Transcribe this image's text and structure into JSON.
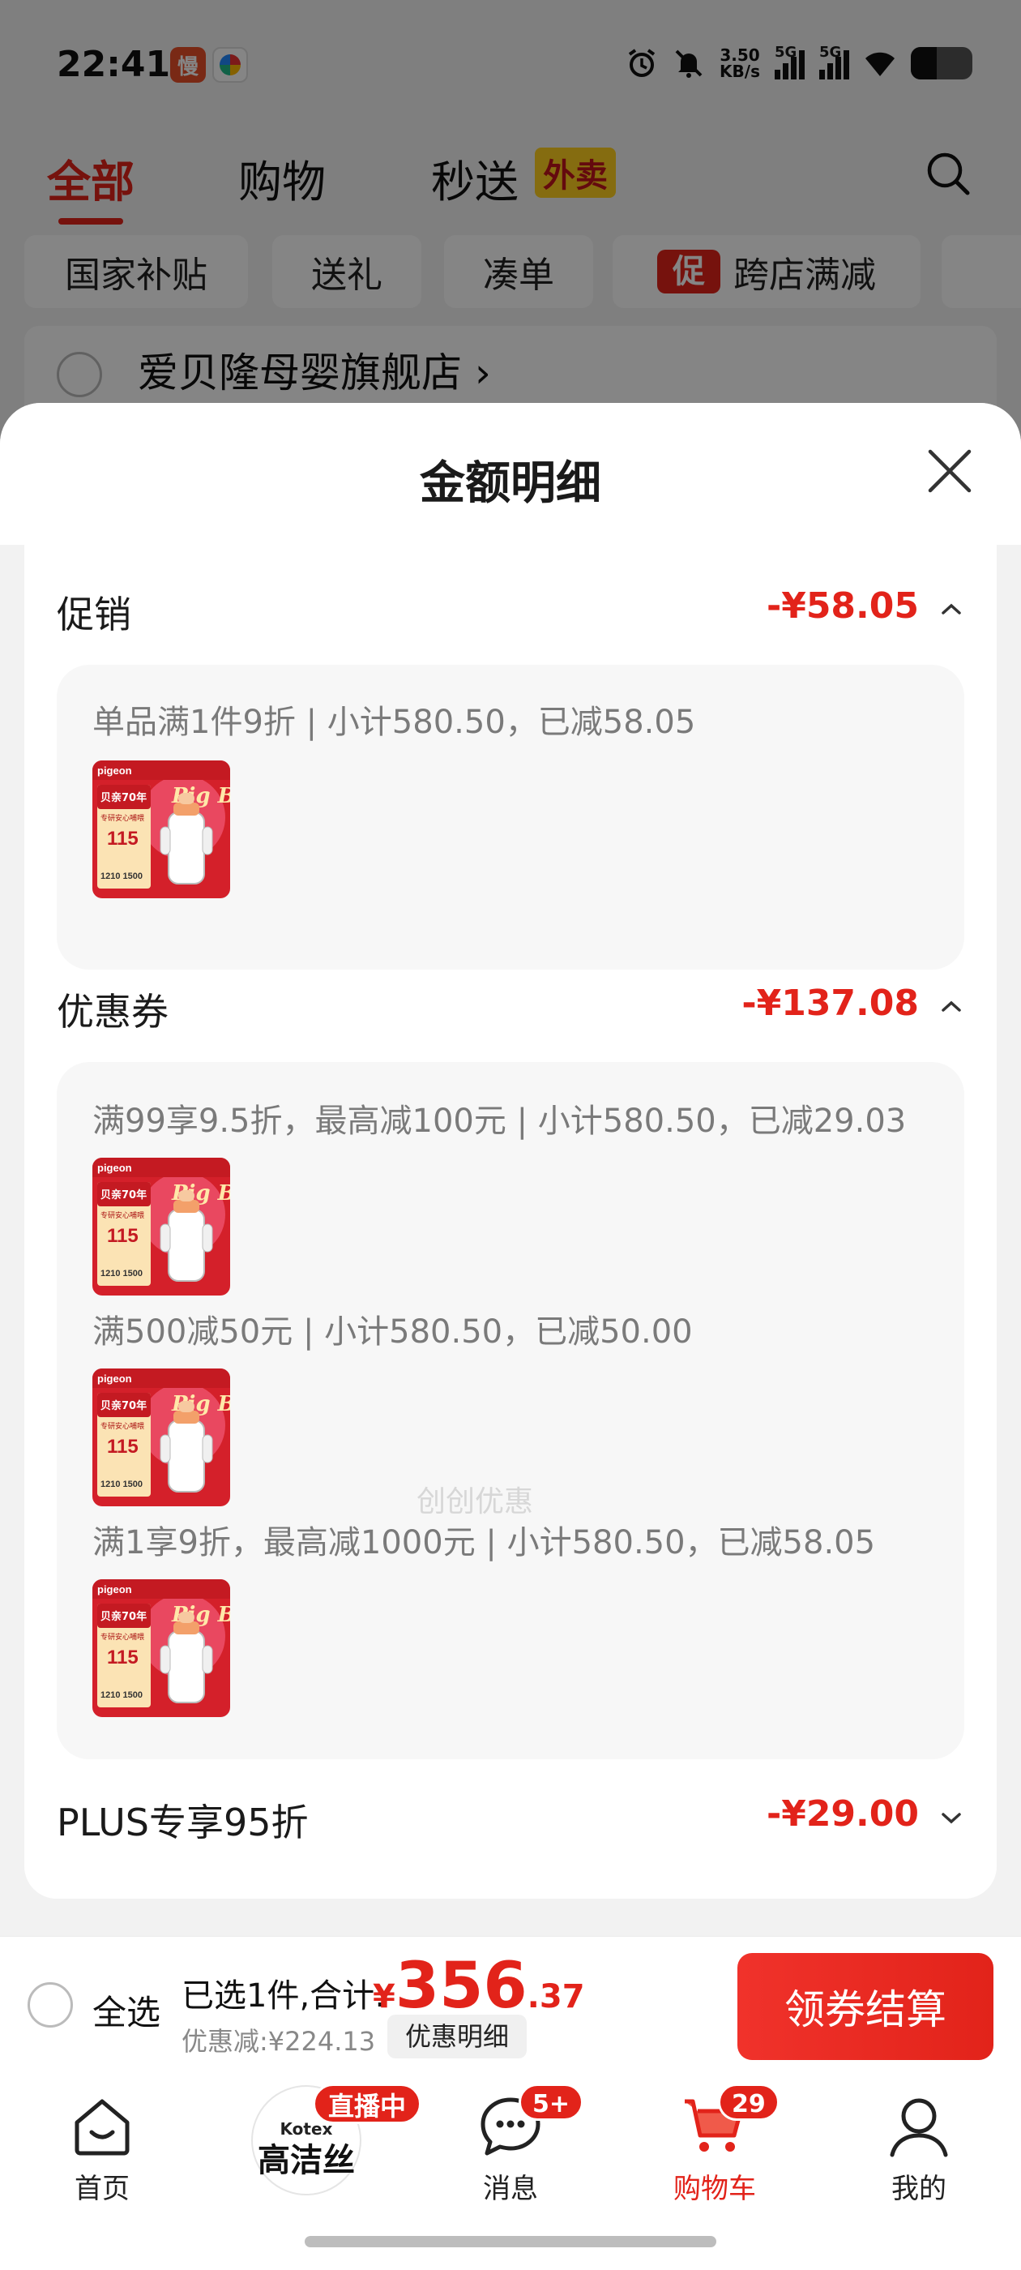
{
  "status_bar": {
    "time": "22:41",
    "app_badge_1": "慢",
    "net_speed_value": "3.50",
    "net_speed_unit": "KB/s",
    "signal_1_label": "5G",
    "signal_2_label": "5G",
    "battery_level": 0.45
  },
  "top_tabs": {
    "items": [
      "全部",
      "购物",
      "秒送"
    ],
    "active": "全部",
    "tag": "外卖"
  },
  "chips": {
    "items": [
      "国家补贴",
      "送礼",
      "凑单",
      "跨店满减"
    ],
    "promo_icon": "促"
  },
  "store": {
    "name": "爱贝隆母婴旗舰店",
    "chevron": "›"
  },
  "sheet": {
    "title": "金额明细",
    "sections": [
      {
        "title": "促销",
        "amount": "-¥58.05",
        "expanded": true,
        "rules": [
          "单品满1件9折 | 小计580.50，已减58.05"
        ]
      },
      {
        "title": "优惠券",
        "amount": "-¥137.08",
        "expanded": true,
        "rules": [
          "满99享9.5折，最高减100元 | 小计580.50，已减29.03",
          "满500减50元 | 小计580.50，已减50.00",
          "满1享9折，最高减1000元 | 小计580.50，已减58.05"
        ]
      },
      {
        "title": "PLUS专享95折",
        "amount": "-¥29.00",
        "expanded": false,
        "rules": []
      }
    ],
    "watermark": "创创优惠"
  },
  "product_thumb": {
    "brand": "pigeon",
    "headline": "贝亲70年",
    "sub": "专研安心哺喂",
    "price": "115",
    "numbers": "1210 1500",
    "art": "Pig Bon"
  },
  "checkout": {
    "select_all": "全选",
    "selected_text": "已选1件,合计:",
    "currency": "¥",
    "total_int": "356",
    "total_dec": ".37",
    "discount_text": "优惠减:¥224.13",
    "detail_button": "优惠明细",
    "pay_button": "领券结算"
  },
  "bottom_nav": {
    "home": "首页",
    "live_brand_top": "Kotex",
    "live_brand": "高洁丝",
    "live_badge": "直播中",
    "messages": "消息",
    "messages_badge": "5+",
    "cart": "购物车",
    "cart_badge": "29",
    "mine": "我的"
  },
  "colors": {
    "accent": "#e2231a",
    "tag_yellow": "#ffcf1f",
    "panel_bg": "#f7f7f7",
    "muted_text": "#7a7a7a"
  },
  "icons": [
    "alarm-icon",
    "mute-icon",
    "wifi-icon",
    "battery-icon",
    "search-icon",
    "close-icon",
    "chevron-up-icon",
    "chevron-down-icon",
    "home-icon",
    "message-icon",
    "cart-icon",
    "user-icon"
  ]
}
